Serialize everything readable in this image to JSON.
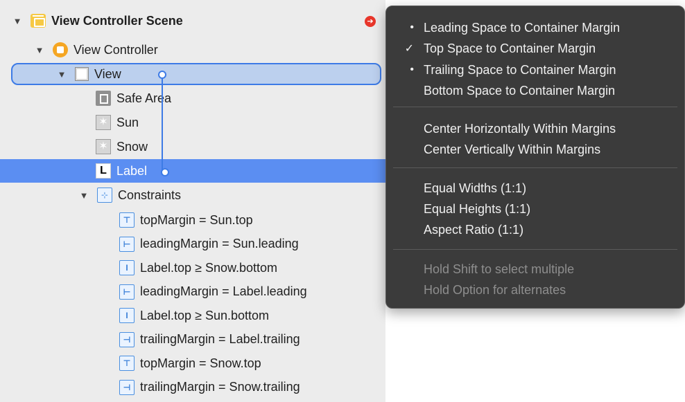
{
  "outline": {
    "scene": {
      "label": "View Controller Scene",
      "warning_glyph": "➔"
    },
    "view_controller": {
      "label": "View Controller"
    },
    "view": {
      "label": "View"
    },
    "safe_area": {
      "label": "Safe Area"
    },
    "sun": {
      "label": "Sun"
    },
    "snow": {
      "label": "Snow"
    },
    "label_item": {
      "label": "Label",
      "icon_letter": "L"
    },
    "constraints": {
      "label": "Constraints"
    },
    "constraint_items": [
      {
        "label": "topMargin = Sun.top",
        "glyph": "⊤"
      },
      {
        "label": "leadingMargin = Sun.leading",
        "glyph": "⊢"
      },
      {
        "label": "Label.top ≥ Snow.bottom",
        "glyph": "I"
      },
      {
        "label": "leadingMargin = Label.leading",
        "glyph": "⊢"
      },
      {
        "label": "Label.top ≥ Sun.bottom",
        "glyph": "I"
      },
      {
        "label": "trailingMargin = Label.trailing",
        "glyph": "⊣"
      },
      {
        "label": "topMargin = Snow.top",
        "glyph": "⊤"
      },
      {
        "label": "trailingMargin = Snow.trailing",
        "glyph": "⊣"
      }
    ]
  },
  "menu": {
    "items": [
      {
        "mark": "•",
        "label": "Leading Space to Container Margin"
      },
      {
        "mark": "✓",
        "label": "Top Space to Container Margin"
      },
      {
        "mark": "•",
        "label": "Trailing Space to Container Margin"
      },
      {
        "mark": "",
        "label": "Bottom Space to Container Margin"
      },
      {
        "mark": "",
        "label": "Center Horizontally Within Margins"
      },
      {
        "mark": "",
        "label": "Center Vertically Within Margins"
      },
      {
        "mark": "",
        "label": "Equal Widths (1:1)"
      },
      {
        "mark": "",
        "label": "Equal Heights (1:1)"
      },
      {
        "mark": "",
        "label": "Aspect Ratio (1:1)"
      }
    ],
    "hints": [
      "Hold Shift to select multiple",
      "Hold Option for alternates"
    ]
  },
  "colors": {
    "selection": "#5b8ef2",
    "drag_outline": "#3d7be6",
    "menu_bg": "#3b3b3b"
  }
}
